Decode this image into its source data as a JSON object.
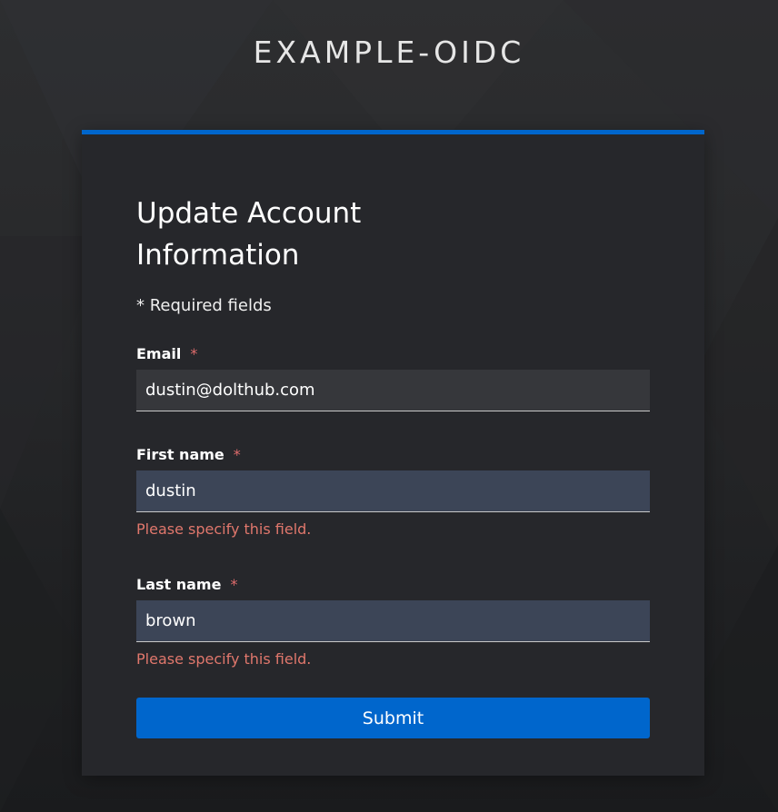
{
  "realm": {
    "title": "EXAMPLE-OIDC"
  },
  "form": {
    "title": "Update Account Information",
    "required_note": "* Required fields",
    "required_marker": "*",
    "fields": {
      "email": {
        "label": "Email",
        "value": "dustin@dolthub.com"
      },
      "first_name": {
        "label": "First name",
        "value": "dustin",
        "error": "Please specify this field."
      },
      "last_name": {
        "label": "Last name",
        "value": "brown",
        "error": "Please specify this field."
      }
    },
    "submit_label": "Submit"
  },
  "colors": {
    "accent": "#0066cc",
    "card_background": "#26272b",
    "error_text": "#e0776c",
    "required_star": "#e06c6c",
    "autofill_background": "#3c4557"
  }
}
